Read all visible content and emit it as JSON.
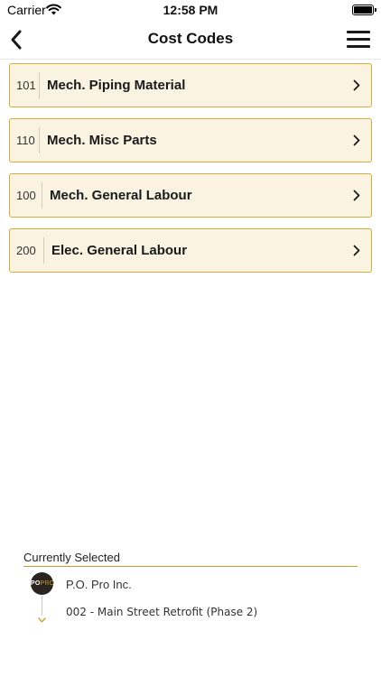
{
  "status_bar": {
    "carrier": "Carrier",
    "time": "12:58 PM",
    "wifi_icon": "wifi-icon",
    "battery_icon": "battery-icon"
  },
  "nav": {
    "title": "Cost Codes",
    "back_icon": "chevron-left-icon",
    "menu_icon": "hamburger-menu-icon"
  },
  "cost_codes": [
    {
      "code": "101",
      "name": "Mech. Piping Material"
    },
    {
      "code": "110",
      "name": "Mech. Misc Parts"
    },
    {
      "code": "100",
      "name": "Mech. General Labour"
    },
    {
      "code": "200",
      "name": "Elec. General Labour"
    }
  ],
  "currently_selected": {
    "heading": "Currently Selected",
    "logo_text": "PO",
    "logo_text_accent": "PRO",
    "company": "P.O. Pro Inc.",
    "project": "002 - Main Street Retrofit (Phase 2)"
  },
  "colors": {
    "row_background": "#fbf3e2",
    "row_border": "#d4ad3a",
    "accent": "#c89f2e"
  }
}
